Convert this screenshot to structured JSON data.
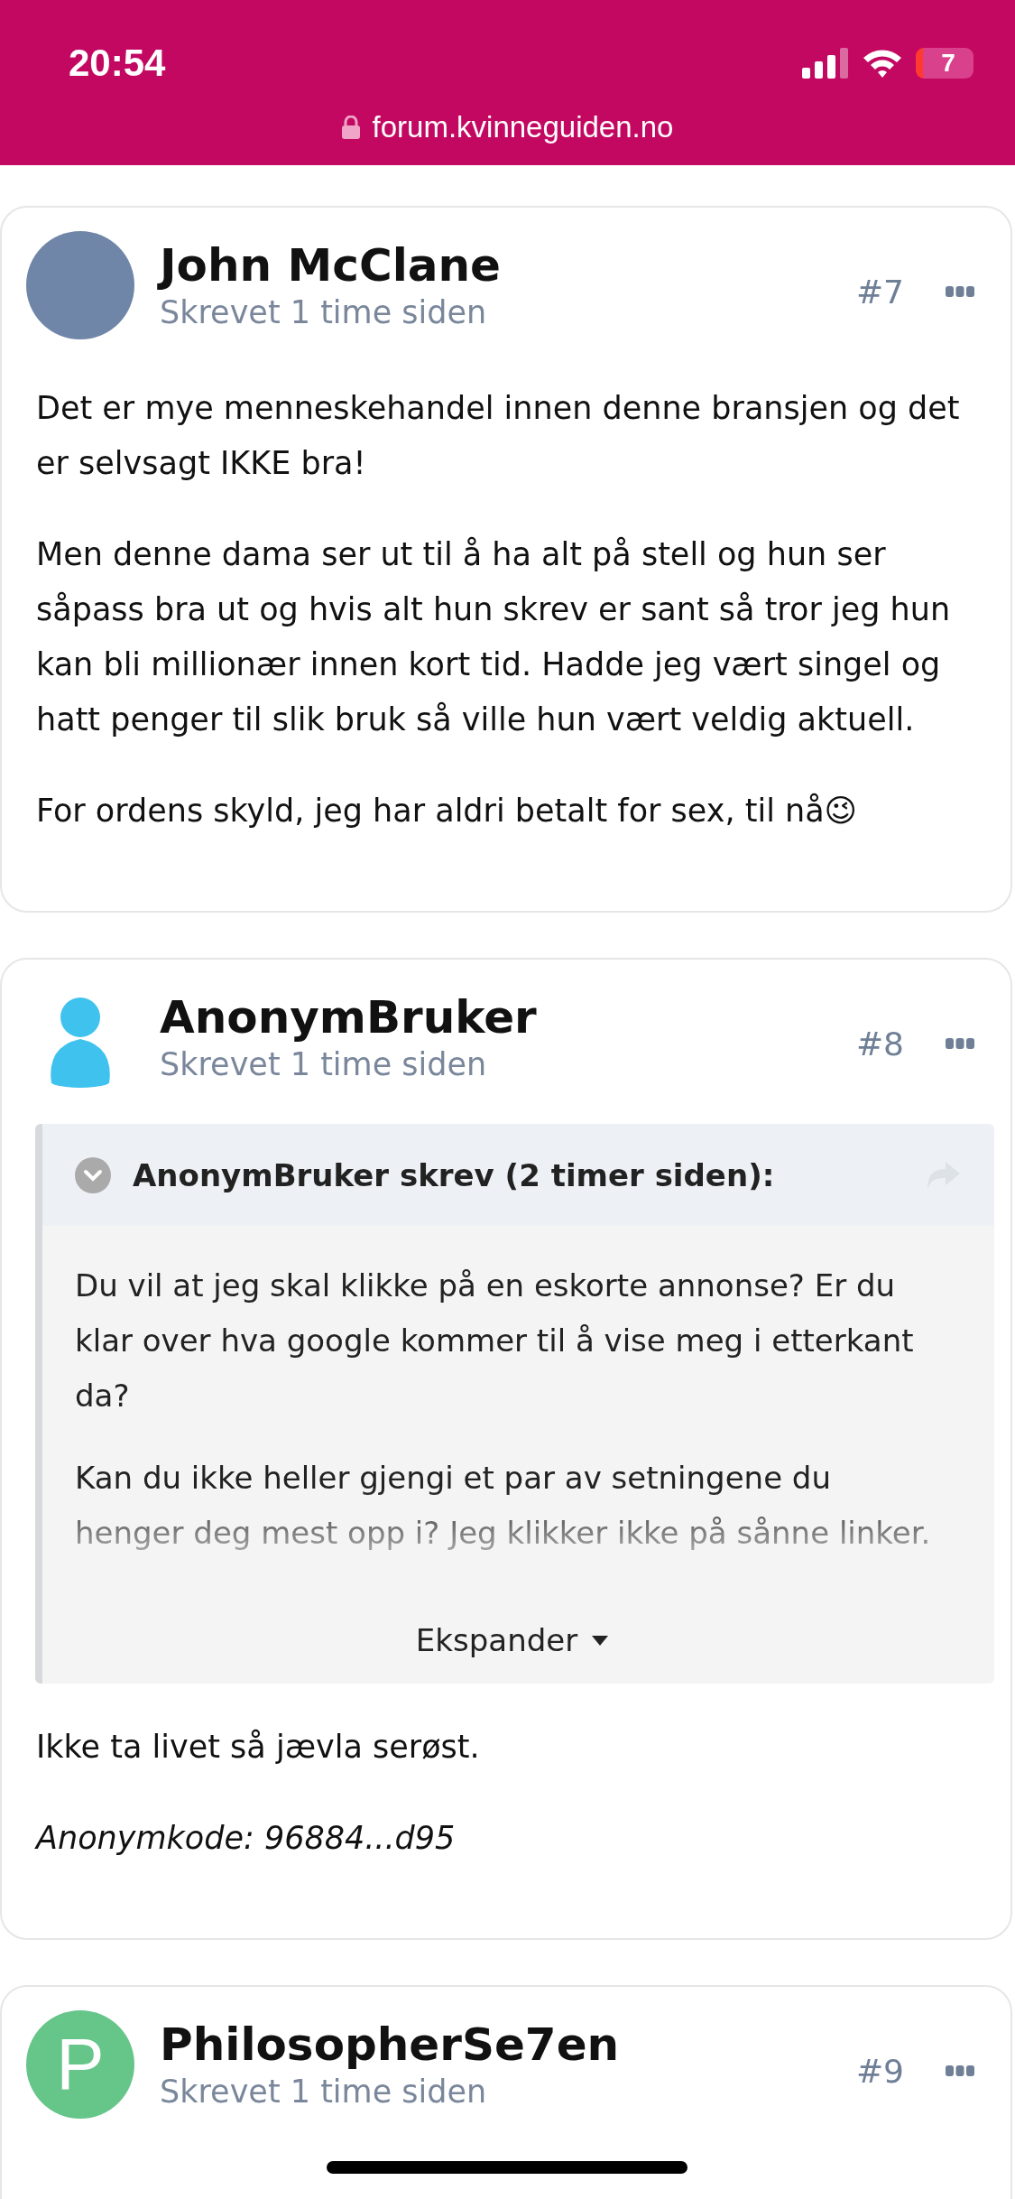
{
  "status_bar": {
    "time": "20:54",
    "battery": "7"
  },
  "address_bar": {
    "url": "forum.kvinneguiden.no"
  },
  "posts": [
    {
      "author": "John McClane",
      "avatar": {
        "kind": "photo"
      },
      "meta": "Skrevet 1 time siden",
      "number": "#7",
      "paragraphs": [
        "Det er mye menneskehandel innen denne bransjen og det er selvsagt IKKE bra!",
        "Men denne dama ser ut til å ha alt på stell og hun ser såpass bra ut og hvis alt hun skrev er sant så tror jeg hun kan bli millionær innen kort tid. Hadde jeg vært singel og hatt penger til slik bruk så ville hun vært veldig aktuell.",
        "For ordens skyld, jeg har aldri betalt for sex, til nå😉"
      ]
    },
    {
      "author": "AnonymBruker",
      "avatar": {
        "kind": "silhouette",
        "color": "#3fc3ee"
      },
      "meta": "Skrevet 1 time siden",
      "number": "#8",
      "quote": {
        "header": "AnonymBruker skrev (2 timer siden):",
        "paragraphs": [
          "Du vil at jeg skal klikke på en eskorte annonse? Er du klar over hva google kommer til å vise meg i etterkant da?",
          "Kan du ikke heller gjengi et par av setningene du henger deg mest opp i? Jeg klikker ikke på sånne linker."
        ],
        "expand_label": "Ekspander"
      },
      "paragraphs": [
        "Ikke ta livet så jævla serøst."
      ],
      "signature": "Anonymkode: 96884...d95"
    },
    {
      "author": "PhilosopherSe7en",
      "avatar": {
        "kind": "letter",
        "letter": "P",
        "color": "#66c68a"
      },
      "meta": "Skrevet 1 time siden",
      "number": "#9"
    }
  ]
}
